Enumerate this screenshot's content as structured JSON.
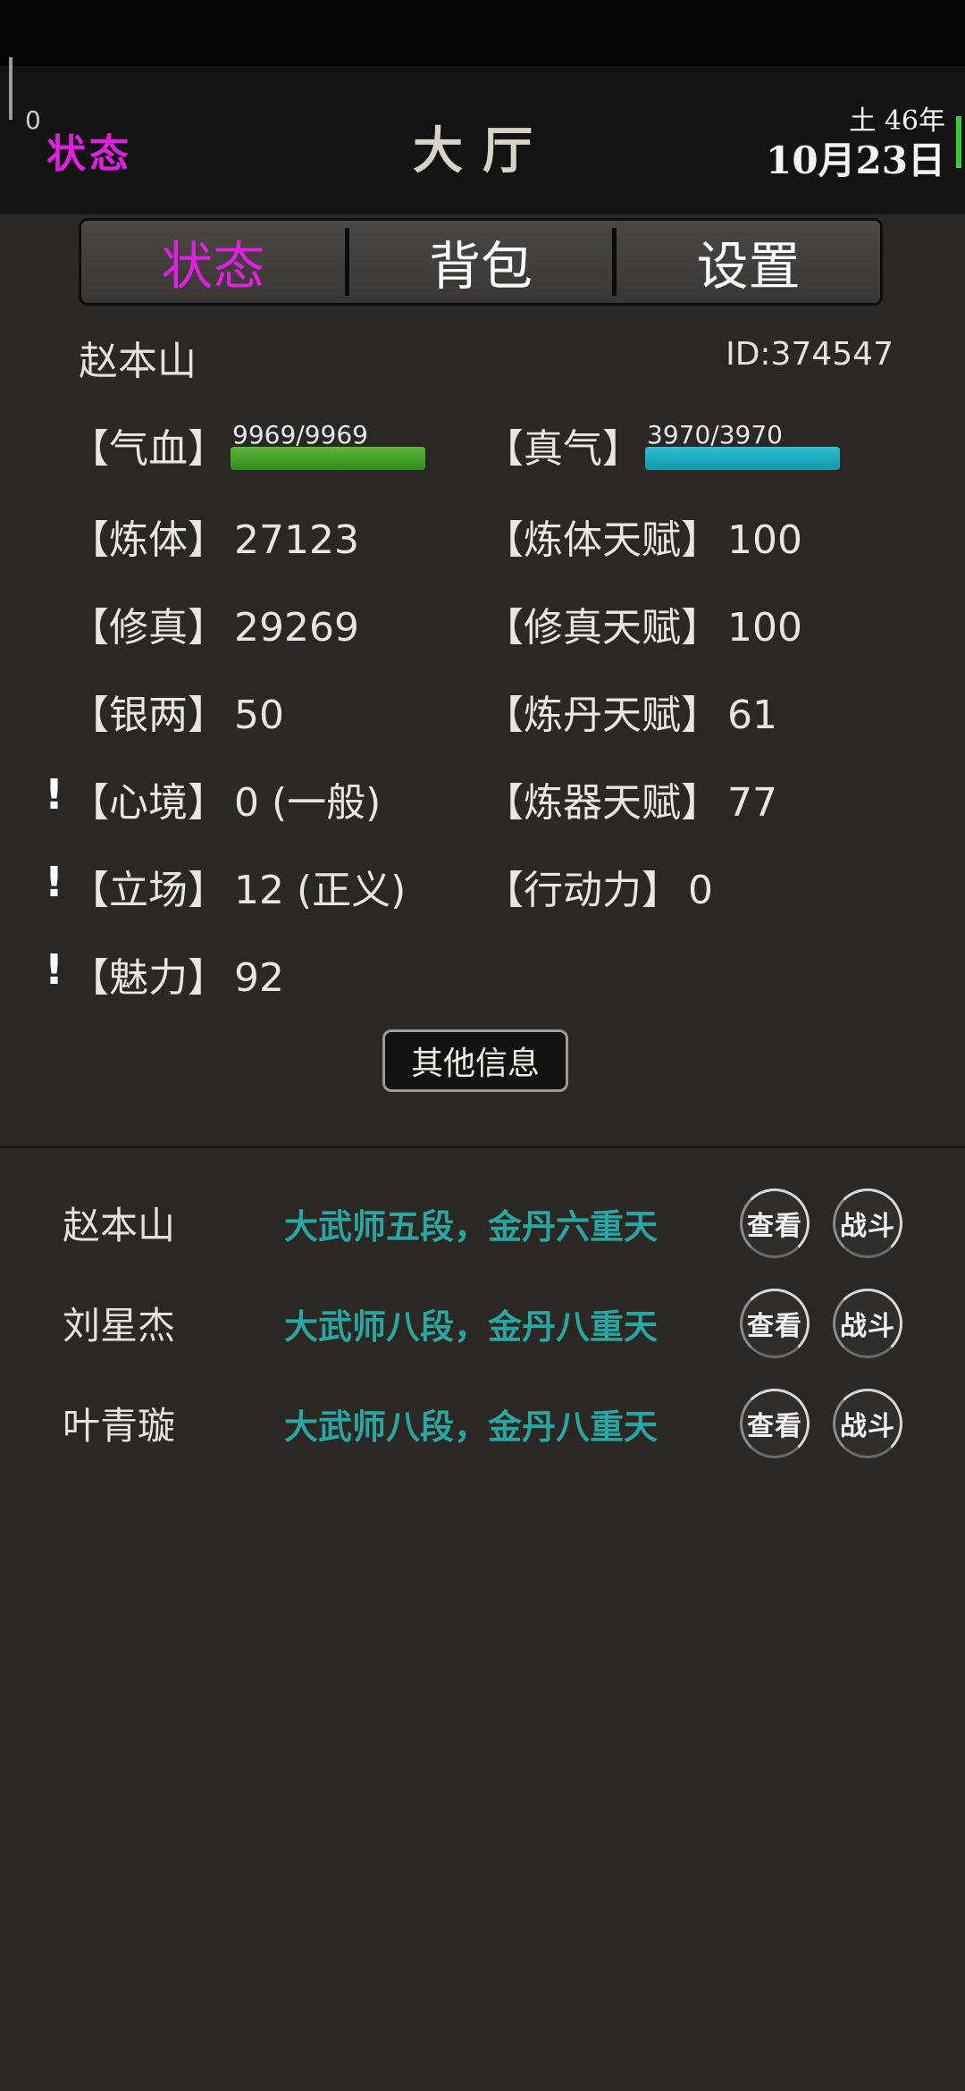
{
  "header": {
    "counter": "0",
    "status_link": "状态",
    "title": "大厅",
    "date_top": "土 46年",
    "date_main": "10月23日"
  },
  "tabs": [
    {
      "label": "状态",
      "active": true
    },
    {
      "label": "背包",
      "active": false
    },
    {
      "label": "设置",
      "active": false
    }
  ],
  "character": {
    "name": "赵本山",
    "id": "ID:374547"
  },
  "bars": {
    "hp": {
      "key": "【气血】",
      "text": "9969/9969",
      "fraction": 1.0
    },
    "mp": {
      "key": "【真气】",
      "text": "3970/3970",
      "fraction": 1.0
    }
  },
  "stats_left": [
    {
      "key": "【炼体】",
      "value": "27123"
    },
    {
      "key": "【修真】",
      "value": "29269"
    },
    {
      "key": "【银两】",
      "value": "50"
    },
    {
      "key": "【心境】",
      "value": "0 (一般)"
    },
    {
      "key": "【立场】",
      "value": "12 (正义)"
    },
    {
      "key": "【魅力】",
      "value": "92"
    }
  ],
  "stats_right": [
    {
      "key": "【炼体天赋】",
      "value": "100"
    },
    {
      "key": "【修真天赋】",
      "value": "100"
    },
    {
      "key": "【炼丹天赋】",
      "value": "61"
    },
    {
      "key": "【炼器天赋】",
      "value": "77"
    },
    {
      "key": "【行动力】",
      "value": "0"
    }
  ],
  "alert_mark": "!",
  "other_info_label": "其他信息",
  "players": [
    {
      "name": "赵本山",
      "rank": "大武师五段，金丹六重天",
      "view_label": "查看",
      "fight_label": "战斗"
    },
    {
      "name": "刘星杰",
      "rank": "大武师八段，金丹八重天",
      "view_label": "查看",
      "fight_label": "战斗"
    },
    {
      "name": "叶青璇",
      "rank": "大武师八段，金丹八重天",
      "view_label": "查看",
      "fight_label": "战斗"
    }
  ],
  "colors": {
    "active_tab": "#e020e0",
    "rank_text": "#2aa5a0",
    "hp_bar": "#3d9a22",
    "mp_bar": "#1fb0c2"
  }
}
